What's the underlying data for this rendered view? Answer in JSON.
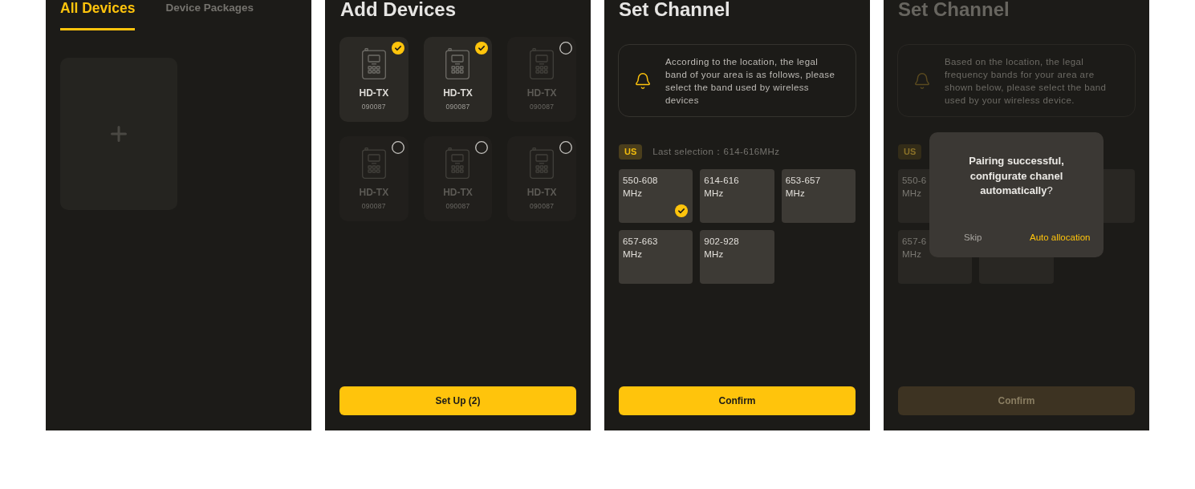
{
  "screens": [
    {
      "kind": "device_list",
      "tabs": [
        {
          "label": "All Devices",
          "selected": true
        },
        {
          "label": "Device Packages",
          "selected": false
        }
      ]
    },
    {
      "kind": "add_devices",
      "title": "Add Devices",
      "devices": [
        {
          "name": "HD-TX",
          "serial": "090087",
          "selected": true
        },
        {
          "name": "HD-TX",
          "serial": "090087",
          "selected": true
        },
        {
          "name": "HD-TX",
          "serial": "090087",
          "selected": false
        },
        {
          "name": "HD-TX",
          "serial": "090087",
          "selected": false
        },
        {
          "name": "HD-TX",
          "serial": "090087",
          "selected": false
        },
        {
          "name": "HD-TX",
          "serial": "090087",
          "selected": false
        }
      ],
      "button": "Set Up (2)"
    },
    {
      "kind": "set_channel",
      "title": "Set Channel",
      "notice_lines": [
        "According to the location, the legal",
        "band of your area is as follows, please",
        "select the band used by wireless",
        "devices"
      ],
      "region": "US",
      "last_selection": "Last selection：614-616MHz",
      "bands": [
        {
          "kind": "tile",
          "lines": [
            "550-608",
            "MHz"
          ],
          "selected": true
        },
        {
          "kind": "tile",
          "lines": [
            "614-616",
            "MHz"
          ],
          "selected": false
        },
        {
          "kind": "tile",
          "lines": [
            "653-657",
            "MHz"
          ],
          "selected": false
        },
        {
          "kind": "tile",
          "lines": [
            "657-663",
            "MHz"
          ],
          "selected": false
        },
        {
          "kind": "tile",
          "lines": [
            "902-928",
            "MHz"
          ],
          "selected": false
        }
      ],
      "button": "Confirm"
    },
    {
      "kind": "set_channel",
      "title": "Set Channel",
      "notice_lines": [
        "Based on the location, the legal",
        "frequency bands for your area are",
        "shown below, please select the band",
        "used by your wireless device."
      ],
      "region": "US",
      "bands": [
        {
          "kind": "tile",
          "lines": [
            "550-6",
            "MHz"
          ]
        },
        {
          "kind": "covered"
        },
        {
          "kind": "tile"
        },
        {
          "kind": "tile",
          "lines": [
            "657-6",
            "MHz"
          ]
        },
        {
          "kind": "tile"
        }
      ],
      "button": "Confirm",
      "dialog": {
        "message": "**Pairing successful, configurate chanel automatically**?",
        "actions": [
          {
            "label": "Skip",
            "kind": "secondary"
          },
          {
            "label": "Auto allocation",
            "kind": "primary"
          }
        ]
      }
    }
  ]
}
